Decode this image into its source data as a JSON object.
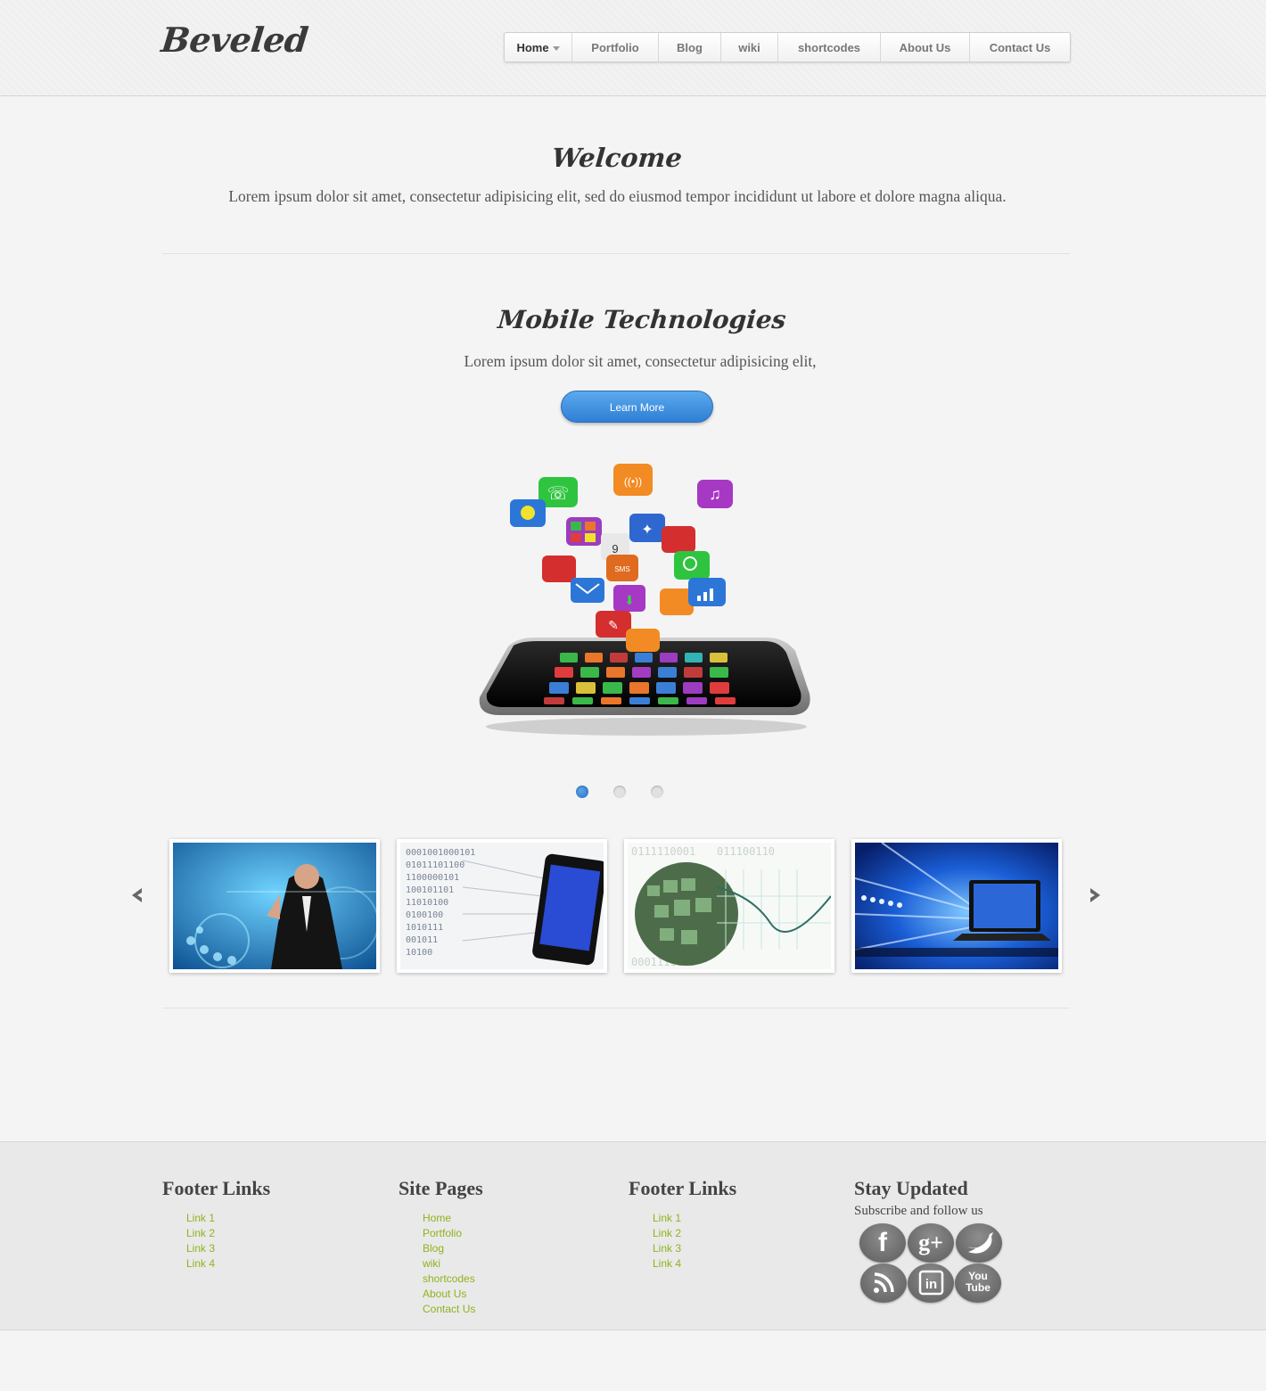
{
  "brand": {
    "logo": "Beveled"
  },
  "nav": {
    "items": [
      {
        "label": "Home",
        "active": true
      },
      {
        "label": "Portfolio"
      },
      {
        "label": "Blog"
      },
      {
        "label": "wiki"
      },
      {
        "label": "shortcodes"
      },
      {
        "label": "About Us"
      },
      {
        "label": "Contact Us"
      }
    ]
  },
  "welcome": {
    "title": "Welcome",
    "text": "Lorem ipsum dolor sit amet, consectetur adipisicing elit, sed do eiusmod tempor incididunt ut labore et dolore magna aliqua."
  },
  "slider": {
    "title": "Mobile Technologies",
    "text": "Lorem ipsum dolor sit amet, consectetur adipisicing elit,",
    "button_label": "Learn More",
    "active_slide": 1,
    "slide_count": 3
  },
  "carousel": {
    "prev_icon": "chevron-left-icon",
    "next_icon": "chevron-right-icon",
    "thumbnails": [
      "businessman-touchscreen",
      "binary-tablet",
      "digital-globe",
      "laptop-network"
    ]
  },
  "footer": {
    "col1": {
      "heading": "Footer Links",
      "links": [
        "Link 1",
        "Link 2",
        "Link 3",
        "Link 4"
      ]
    },
    "col2": {
      "heading": "Site Pages",
      "links": [
        "Home",
        "Portfolio",
        "Blog",
        "wiki",
        "shortcodes",
        "About Us",
        "Contact Us"
      ]
    },
    "col3": {
      "heading": "Footer Links",
      "links": [
        "Link 1",
        "Link 2",
        "Link 3",
        "Link 4"
      ]
    },
    "col4": {
      "heading": "Stay Updated",
      "subtext": "Subscribe and follow us",
      "social": [
        {
          "name": "facebook-icon",
          "glyph": "f"
        },
        {
          "name": "google-plus-icon",
          "glyph": "g+"
        },
        {
          "name": "twitter-icon",
          "glyph": ""
        },
        {
          "name": "rss-icon",
          "glyph": ""
        },
        {
          "name": "linkedin-icon",
          "glyph": "in"
        },
        {
          "name": "youtube-icon",
          "glyph": "You Tube"
        }
      ]
    }
  },
  "colors": {
    "accent_blue": "#3a8ee0",
    "link_green": "#8fb31c"
  }
}
